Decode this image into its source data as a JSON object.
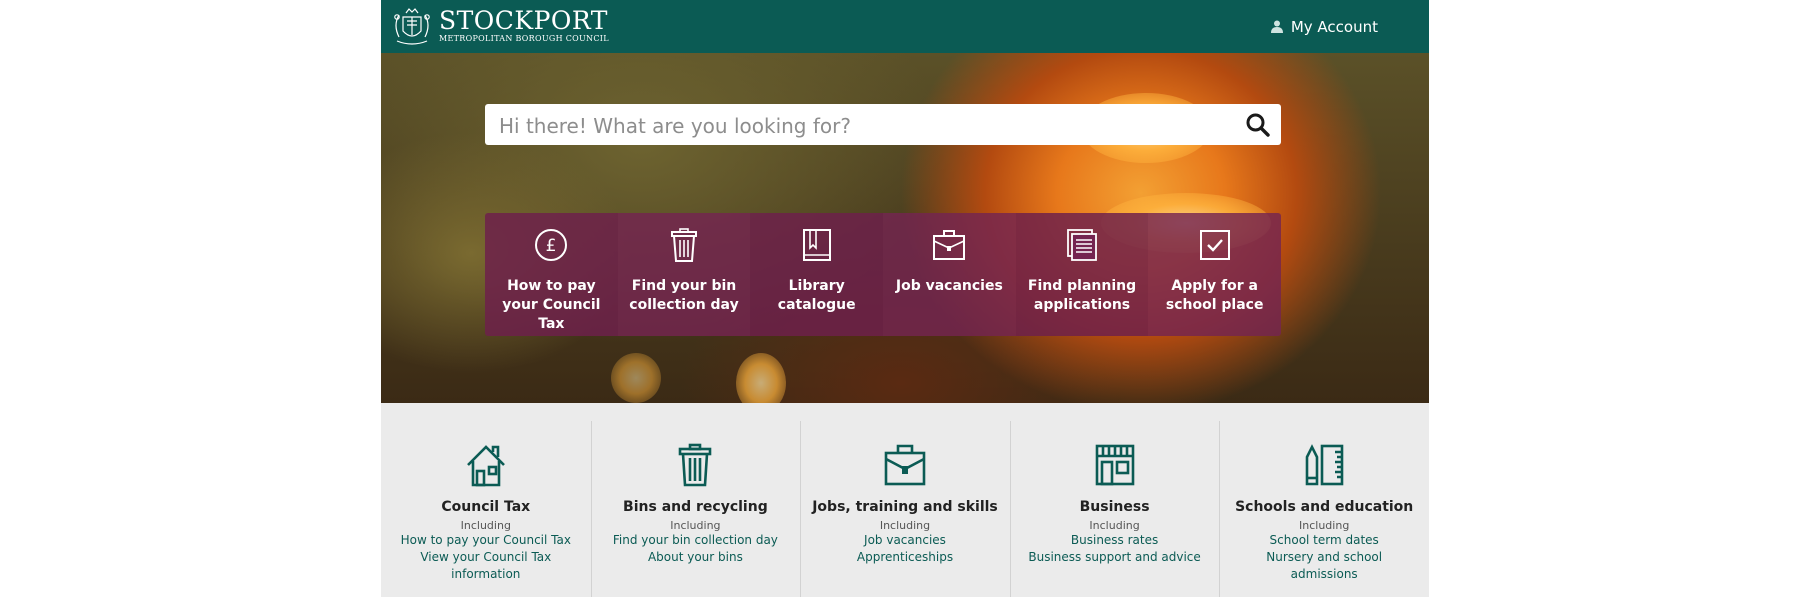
{
  "header": {
    "logo_title": "STOCKPORT",
    "logo_subtitle": "METROPOLITAN BOROUGH COUNCIL",
    "account_label": "My Account",
    "background_color": "#0b5b54"
  },
  "search": {
    "placeholder": "Hi there! What are you looking for?",
    "value": "",
    "button_icon": "search-icon"
  },
  "quick_links": [
    {
      "label": "How to pay your Council Tax",
      "icon": "pound-icon"
    },
    {
      "label": "Find your bin collection day",
      "icon": "bin-icon"
    },
    {
      "label": "Library catalogue",
      "icon": "book-icon"
    },
    {
      "label": "Job vacancies",
      "icon": "briefcase-icon"
    },
    {
      "label": "Find planning applications",
      "icon": "documents-icon"
    },
    {
      "label": "Apply for a school place",
      "icon": "checkbox-icon"
    }
  ],
  "quick_links_color": "#6e204b",
  "services": [
    {
      "title": "Council Tax",
      "including": "Including",
      "icon": "house-icon",
      "links": [
        "How to pay your Council Tax",
        "View your Council Tax information"
      ]
    },
    {
      "title": "Bins and recycling",
      "including": "Including",
      "icon": "bin-icon",
      "links": [
        "Find your bin collection day",
        "About your bins"
      ]
    },
    {
      "title": "Jobs, training and skills",
      "including": "Including",
      "icon": "briefcase-icon",
      "links": [
        "Job vacancies",
        "Apprenticeships"
      ]
    },
    {
      "title": "Business",
      "including": "Including",
      "icon": "shop-icon",
      "links": [
        "Business rates",
        "Business support and advice"
      ]
    },
    {
      "title": "Schools and education",
      "including": "Including",
      "icon": "school-supplies-icon",
      "links": [
        "School term dates",
        "Nursery and school admissions"
      ]
    }
  ],
  "accent_color": "#0b5b54"
}
